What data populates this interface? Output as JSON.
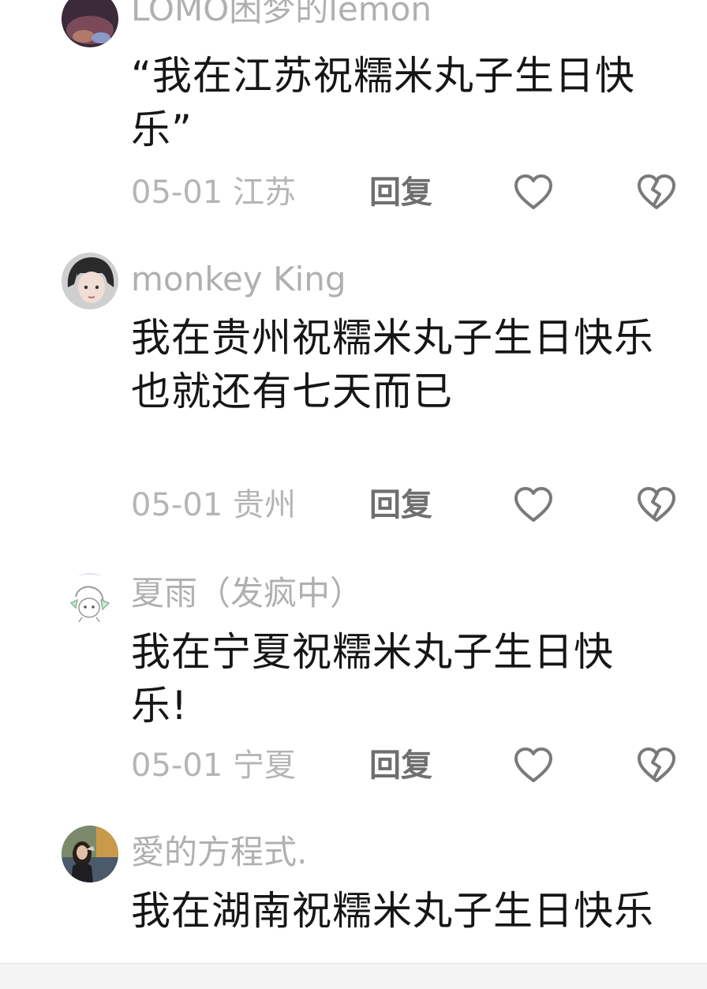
{
  "comments": [
    {
      "username": "LOMO困梦的lemon",
      "text": "“我在江苏祝糯米丸子生日快乐”",
      "date_location": "05-01 江苏",
      "reply_label": "回复",
      "like_icon": "heart-outline-icon",
      "dislike_icon": "broken-heart-icon"
    },
    {
      "username": "monkey King",
      "text": "我在贵州祝糯米丸子生日快乐\n也就还有七天而已",
      "date_location": "05-01 贵州",
      "reply_label": "回复",
      "like_icon": "heart-outline-icon",
      "dislike_icon": "broken-heart-icon"
    },
    {
      "username": "夏雨（发疯中）",
      "text": "我在宁夏祝糯米丸子生日快乐!",
      "date_location": "05-01 宁夏",
      "reply_label": "回复",
      "like_icon": "heart-outline-icon",
      "dislike_icon": "broken-heart-icon"
    },
    {
      "username": "愛的方程式.",
      "text": "我在湖南祝糯米丸子生日快乐"
    }
  ],
  "colors": {
    "username": "#b0b0b0",
    "body_text": "#161616",
    "meta_text": "#b5b5b5",
    "reply_text": "#6f6f6f",
    "icon_stroke": "#7a7a7a"
  }
}
